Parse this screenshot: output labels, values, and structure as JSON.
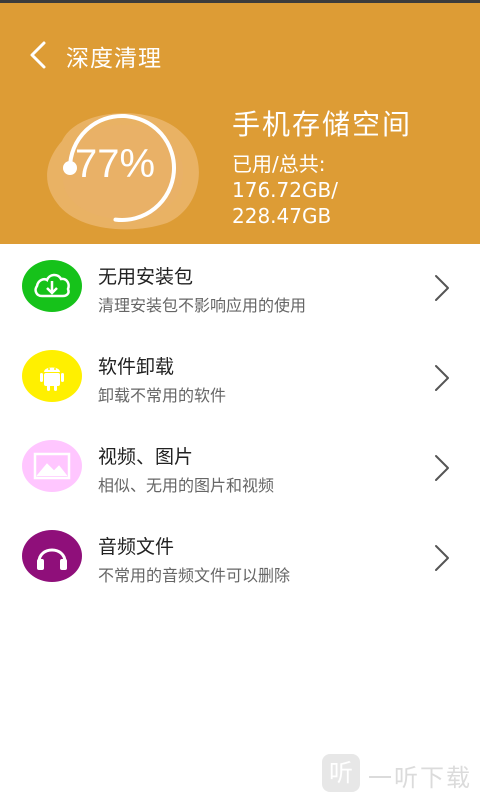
{
  "header": {
    "title": "深度清理",
    "gauge_percent": "77%",
    "gauge_fraction": 0.77,
    "storage_title": "手机存储空间",
    "storage_used_label": "已用/总共:",
    "storage_used": "176.72GB/",
    "storage_total": "228.47GB",
    "bg_color": "#dd9c35"
  },
  "items": [
    {
      "title": "无用安装包",
      "desc": "清理安装包不影响应用的使用",
      "icon": "cloud-download-icon",
      "color": "#16c21a"
    },
    {
      "title": "软件卸载",
      "desc": "卸载不常用的软件",
      "icon": "android-icon",
      "color": "#fff000"
    },
    {
      "title": "视频、图片",
      "desc": "相似、无用的图片和视频",
      "icon": "image-icon",
      "color": "#ffc6ff"
    },
    {
      "title": "音频文件",
      "desc": "不常用的音频文件可以删除",
      "icon": "headphones-icon",
      "color": "#8f0f7a"
    }
  ],
  "watermark": {
    "badge": "听",
    "text": "一听下载"
  }
}
